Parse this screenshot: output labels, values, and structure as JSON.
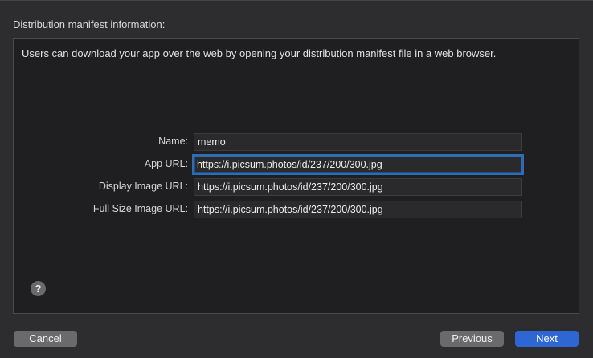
{
  "section_title": "Distribution manifest information:",
  "description": "Users can download your app over the web by opening your distribution manifest file in a web browser.",
  "form": {
    "name": {
      "label": "Name:",
      "value": "memo"
    },
    "app_url": {
      "label": "App URL:",
      "value": "https://i.picsum.photos/id/237/200/300.jpg"
    },
    "display_image_url": {
      "label": "Display Image URL:",
      "value": "https://i.picsum.photos/id/237/200/300.jpg"
    },
    "full_size_image_url": {
      "label": "Full Size Image URL:",
      "value": "https://i.picsum.photos/id/237/200/300.jpg"
    }
  },
  "help_icon": "?",
  "buttons": {
    "cancel": "Cancel",
    "previous": "Previous",
    "next": "Next"
  },
  "colors": {
    "accent": "#2e66d3",
    "focus_ring": "#2e6db4"
  }
}
